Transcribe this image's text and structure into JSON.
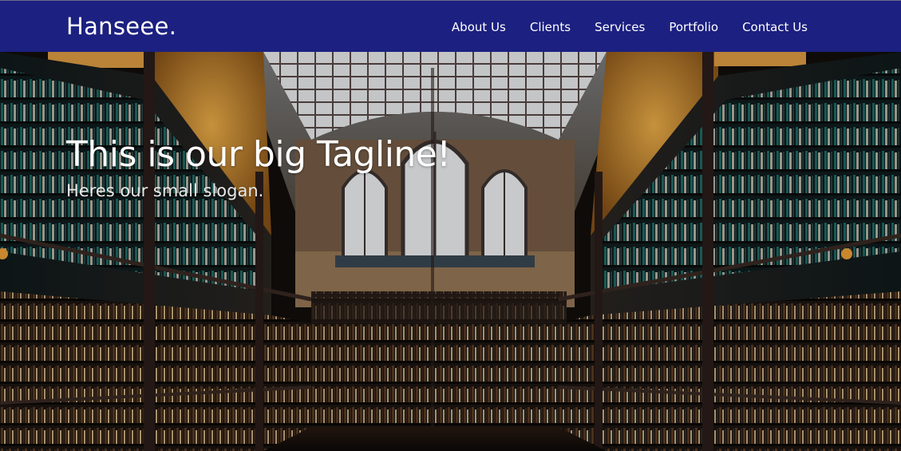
{
  "navbar": {
    "brand": "Hanseee.",
    "links": [
      "About Us",
      "Clients",
      "Services",
      "Portfolio",
      "Contact Us"
    ]
  },
  "hero": {
    "tagline": "This is our big Tagline!",
    "slogan": "Heres our small slogan.",
    "background_image": "library-hall-photo"
  },
  "colors": {
    "navbar_bg": "#1c2080",
    "text": "#ffffff"
  }
}
